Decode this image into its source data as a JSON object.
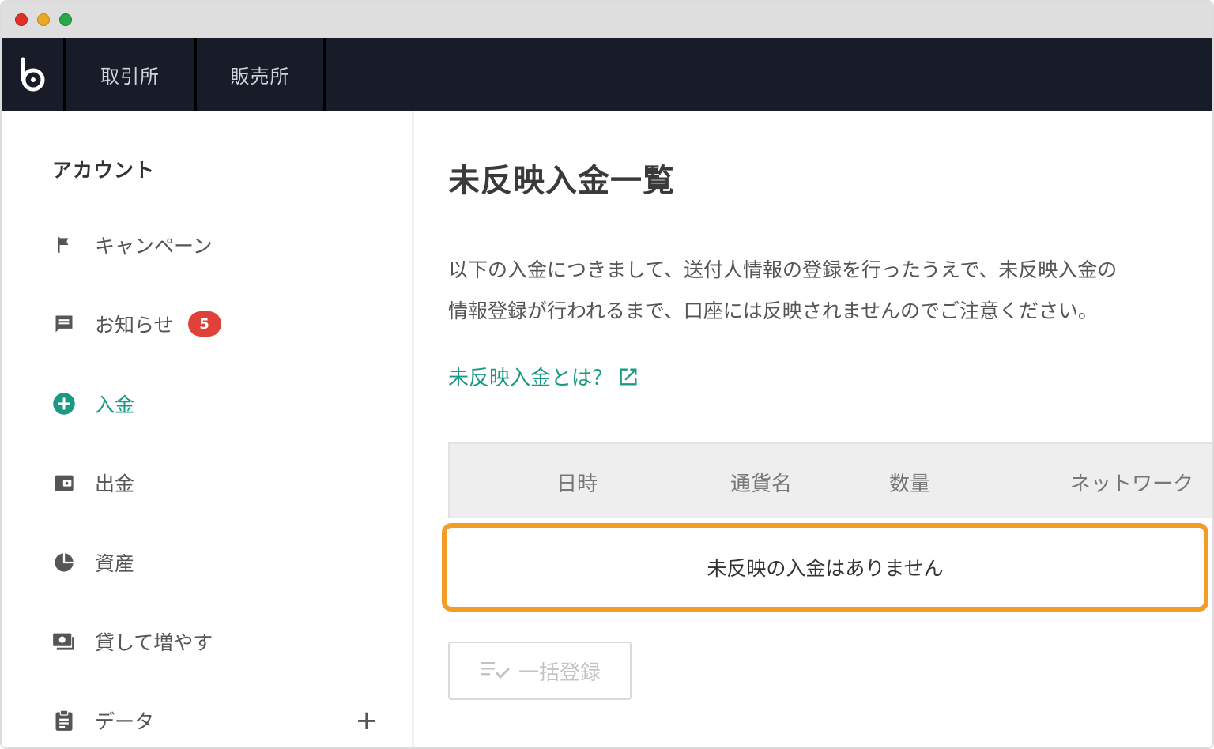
{
  "nav": {
    "items": [
      {
        "label": "取引所"
      },
      {
        "label": "販売所"
      }
    ],
    "logo_icon": "bitbank-logo-icon"
  },
  "sidebar": {
    "heading": "アカウント",
    "items": [
      {
        "label": "キャンペーン",
        "icon": "flag-icon"
      },
      {
        "label": "お知らせ",
        "icon": "message-icon",
        "badge": "5"
      },
      {
        "label": "入金",
        "icon": "plus-circle-icon",
        "active": true
      },
      {
        "label": "出金",
        "icon": "wallet-icon"
      },
      {
        "label": "資産",
        "icon": "pie-chart-icon"
      },
      {
        "label": "貸して増やす",
        "icon": "money-icon"
      },
      {
        "label": "データ",
        "icon": "clipboard-icon",
        "expand": "+"
      }
    ]
  },
  "main": {
    "title": "未反映入金一覧",
    "description": [
      "以下の入金につきまして、送付人情報の登録を行ったうえで、未反映入金の",
      "情報登録が行われるまで、口座には反映されませんのでご注意ください。"
    ],
    "link_label": "未反映入金とは？",
    "table": {
      "headers": [
        "日時",
        "通貨名",
        "数量",
        "ネットワーク"
      ],
      "empty_message": "未反映の入金はありません"
    },
    "bulk_button_label": "一括登録"
  },
  "colors": {
    "accent": "#1a9a84",
    "highlight": "#f39c26",
    "badge": "#e0423a",
    "nav_bg": "#171c28"
  }
}
